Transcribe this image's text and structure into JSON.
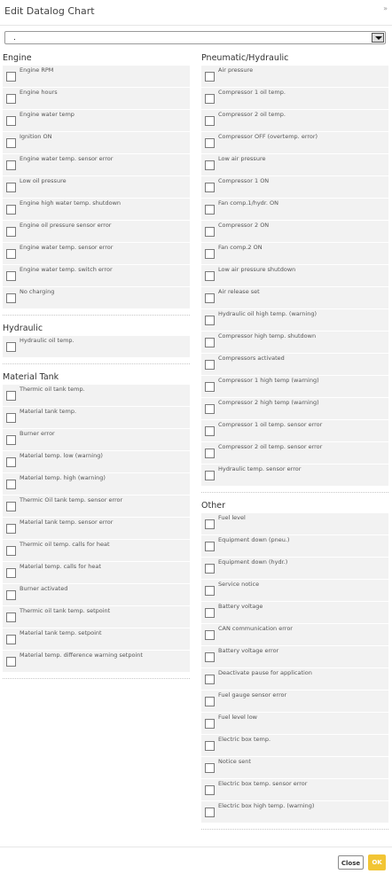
{
  "dialog": {
    "title": "Edit Datalog Chart",
    "close_symbol": "»"
  },
  "selector": {
    "value": "."
  },
  "left_groups": [
    {
      "title": "Engine",
      "items": [
        "Engine RPM",
        "Engine hours",
        "Engine water temp",
        "Ignition ON",
        "Engine water temp. sensor error",
        "Low oil pressure",
        "Engine high water temp. shutdown",
        "Engine oil pressure sensor error",
        "Engine water temp. sensor error",
        "Engine water temp. switch error",
        "No charging"
      ]
    },
    {
      "title": "Hydraulic",
      "items": [
        "Hydraulic oil temp."
      ]
    },
    {
      "title": "Material Tank",
      "items": [
        "Thermic oil tank temp.",
        "Material tank temp.",
        "Burner error",
        "Material temp. low (warning)",
        "Material temp. high (warning)",
        "Thermic Oil tank temp. sensor error",
        "Material tank temp. sensor error",
        "Thermic oil temp. calls for heat",
        "Material temp. calls for heat",
        "Burner activated",
        "Thermic oil tank temp. setpoint",
        "Material tank temp. setpoint",
        "Material temp. difference warning setpoint"
      ]
    }
  ],
  "right_groups": [
    {
      "title": "Pneumatic/Hydraulic",
      "items": [
        "Air pressure",
        "Compressor 1 oil temp.",
        "Compressor 2 oil temp.",
        "Compressor OFF (overtemp. error)",
        "Low air pressure",
        "Compressor 1 ON",
        "Fan comp.1/hydr. ON",
        "Compressor 2 ON",
        "Fan comp.2 ON",
        "Low air pressure shutdown",
        "Air release set",
        "Hydraulic oil high temp. (warning)",
        "Compressor high temp. shutdown",
        "Compressors activated",
        "Compressor 1 high temp (warning)",
        "Compressor 2 high temp (warning)",
        "Compressor 1 oil temp. sensor error",
        "Compressor 2 oil temp. sensor error",
        "Hydraulic temp. sensor error"
      ]
    },
    {
      "title": "Other",
      "items": [
        "Fuel level",
        "Equipment down (pneu.)",
        "Equipment down (hydr.)",
        "Service notice",
        "Battery voltage",
        "CAN communication error",
        "Battery voltage error",
        "Deactivate pause for application",
        "Fuel gauge sensor error",
        "Fuel level low",
        "Electric box temp.",
        "Notice sent",
        "Electric box temp. sensor error",
        "Electric box high temp. (warning)"
      ]
    }
  ],
  "footer": {
    "close_label": "Close",
    "ok_label": "OK"
  },
  "colors": {
    "ok_button": "#f2c534",
    "row_background": "#f2f2f2"
  }
}
